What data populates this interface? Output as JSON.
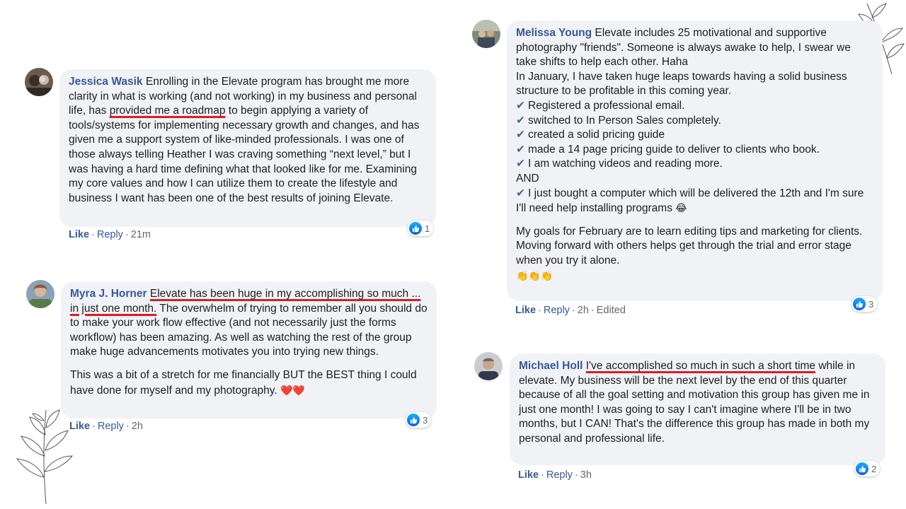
{
  "comments": [
    {
      "author": "Jessica Wasik",
      "text_before": " Enrolling in the Elevate program has brought me more clarity in what is working (and not working) in my business and personal life, has ",
      "text_underlined": "provided me a roadmap",
      "text_after": " to begin applying a variety of tools/systems for implementing necessary growth and changes, and has given me a support system of like-minded professionals. I was one of those always telling Heather I was craving something “next level,” but I was having a hard time defining what that looked like for me. Examining my core values and how I can utilize them to create the lifestyle and business I want has been one of the best results of joining Elevate.",
      "like": "Like",
      "reply": "Reply",
      "time": "21m",
      "reaction_count": "1"
    },
    {
      "author": "Myra J. Horner",
      "text_underlined": "Elevate has been huge in my accomplishing so much ... in just one month.",
      "text_after": " The overwhelm of trying to remember all you should do to make your work flow effective (and not necessarily just the forms workflow) has been amazing. As well as watching the rest of the group make huge advancements motivates you into trying new things.",
      "text_p2": "This was a bit of a stretch for me financially BUT the BEST thing I could have done for myself and my photography.",
      "emoji": "❤️❤️",
      "like": "Like",
      "reply": "Reply",
      "time": "2h",
      "reaction_count": "3"
    },
    {
      "author": "Melissa Young",
      "text_intro": " Elevate includes 25 motivational and supportive photography \"friends\". Someone is always awake to help, I swear we take shifts to help each other. Haha",
      "line_january": "In January, I have taken huge leaps towards having a solid business structure to be profitable in this coming year.",
      "checklist": [
        "Registered a professional email.",
        "switched to In Person Sales completely.",
        "created a solid pricing guide",
        "made a 14 page pricing guide to deliver to clients who book.",
        "I am watching videos and reading more."
      ],
      "and": "AND",
      "last_check": "I just bought a computer which will be delivered the 12th and I'm sure I'll need help installing programs",
      "laugh_emoji": "😂",
      "p2": "My goals for February are to learn editing tips and marketing for clients.",
      "p2b": "Moving forward with others helps get through the trial and error stage when you try it alone.",
      "clap_emoji": "👏👏👏",
      "check_mark": "✔",
      "like": "Like",
      "reply": "Reply",
      "time": "2h",
      "edited": "Edited",
      "reaction_count": "3"
    },
    {
      "author": "Michael Holl",
      "text_underlined": "I've accomplished so much in such a short time",
      "text_after": " while in elevate. My business will be the next level by the end of this quarter because of all the goal setting and motivation this group has given me in just one month! I was going to say I can't imagine where I'll be in two months, but I CAN! That's the difference this group has made in both my personal and professional life.",
      "like": "Like",
      "reply": "Reply",
      "time": "3h",
      "reaction_count": "2"
    }
  ],
  "separator": "·",
  "colors": {
    "link": "#385898",
    "bubble": "#f0f2f5",
    "underline": "#d81e2a"
  }
}
